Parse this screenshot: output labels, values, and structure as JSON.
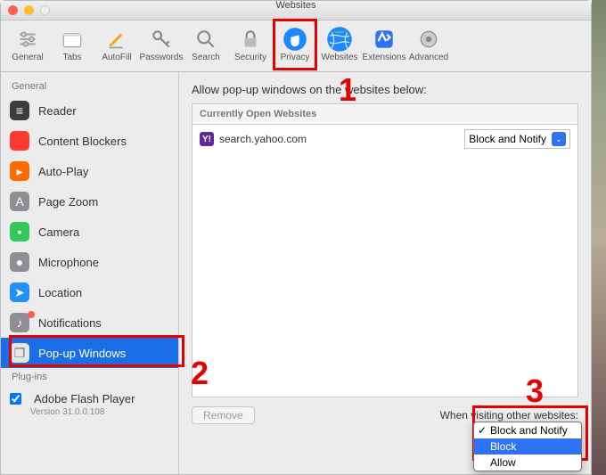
{
  "window": {
    "subtitle_top": "",
    "title": "Websites"
  },
  "toolbar": [
    {
      "key": "general",
      "label": "General",
      "icon": "⚙︎",
      "color": "tb-gray"
    },
    {
      "key": "tabs",
      "label": "Tabs",
      "icon": "▢",
      "color": "tb-gray"
    },
    {
      "key": "autofill",
      "label": "AutoFill",
      "icon": "✎",
      "color": "tb-orange"
    },
    {
      "key": "passwords",
      "label": "Passwords",
      "icon": "🔑",
      "color": "tb-gray"
    },
    {
      "key": "search",
      "label": "Search",
      "icon": "🔍",
      "color": "tb-gray"
    },
    {
      "key": "security",
      "label": "Security",
      "icon": "🔒",
      "color": "tb-gray"
    },
    {
      "key": "privacy",
      "label": "Privacy",
      "icon": "✋",
      "color": "tb-blue"
    },
    {
      "key": "websites",
      "label": "Websites",
      "icon": "🌐",
      "color": "tb-blue",
      "selected": true
    },
    {
      "key": "extensions",
      "label": "Extensions",
      "icon": "✦",
      "color": "tb-purple"
    },
    {
      "key": "advanced",
      "label": "Advanced",
      "icon": "⚙",
      "color": "tb-gray"
    }
  ],
  "sidebar": {
    "section1": "General",
    "items": [
      {
        "label": "Reader",
        "icon_bg": "#3d3d3d",
        "icon": "≡"
      },
      {
        "label": "Content Blockers",
        "icon_bg": "#ff3b30",
        "icon": "⬣"
      },
      {
        "label": "Auto-Play",
        "icon_bg": "#ff6a00",
        "icon": "▶"
      },
      {
        "label": "Page Zoom",
        "icon_bg": "#8e8e93",
        "icon": "🔍"
      },
      {
        "label": "Camera",
        "icon_bg": "#34c759",
        "icon": "📷"
      },
      {
        "label": "Microphone",
        "icon_bg": "#8e8e93",
        "icon": "🎤"
      },
      {
        "label": "Location",
        "icon_bg": "#1e90ff",
        "icon": "➤"
      },
      {
        "label": "Notifications",
        "icon_bg": "#8e8e93",
        "icon": "🔔",
        "badge": true
      },
      {
        "label": "Pop-up Windows",
        "icon_bg": "#e7e7e7",
        "icon": "◻",
        "selected": true
      }
    ],
    "section2": "Plug-ins",
    "plugin": {
      "label": "Adobe Flash Player",
      "version": "Version 31.0.0.108"
    }
  },
  "main": {
    "desc": "Allow pop-up windows on the websites below:",
    "list_header": "Currently Open Websites",
    "rows": [
      {
        "site": "search.yahoo.com",
        "badge": "Y!",
        "action": "Block and Notify"
      }
    ],
    "remove_btn": "Remove",
    "footer_label": "When visiting other websites:",
    "dropdown_options": [
      "Block and Notify",
      "Block",
      "Allow"
    ],
    "dropdown_selected": "Block",
    "dropdown_checked": "Block and Notify"
  },
  "annotations": {
    "n1": "1",
    "n2": "2",
    "n3": "3"
  }
}
